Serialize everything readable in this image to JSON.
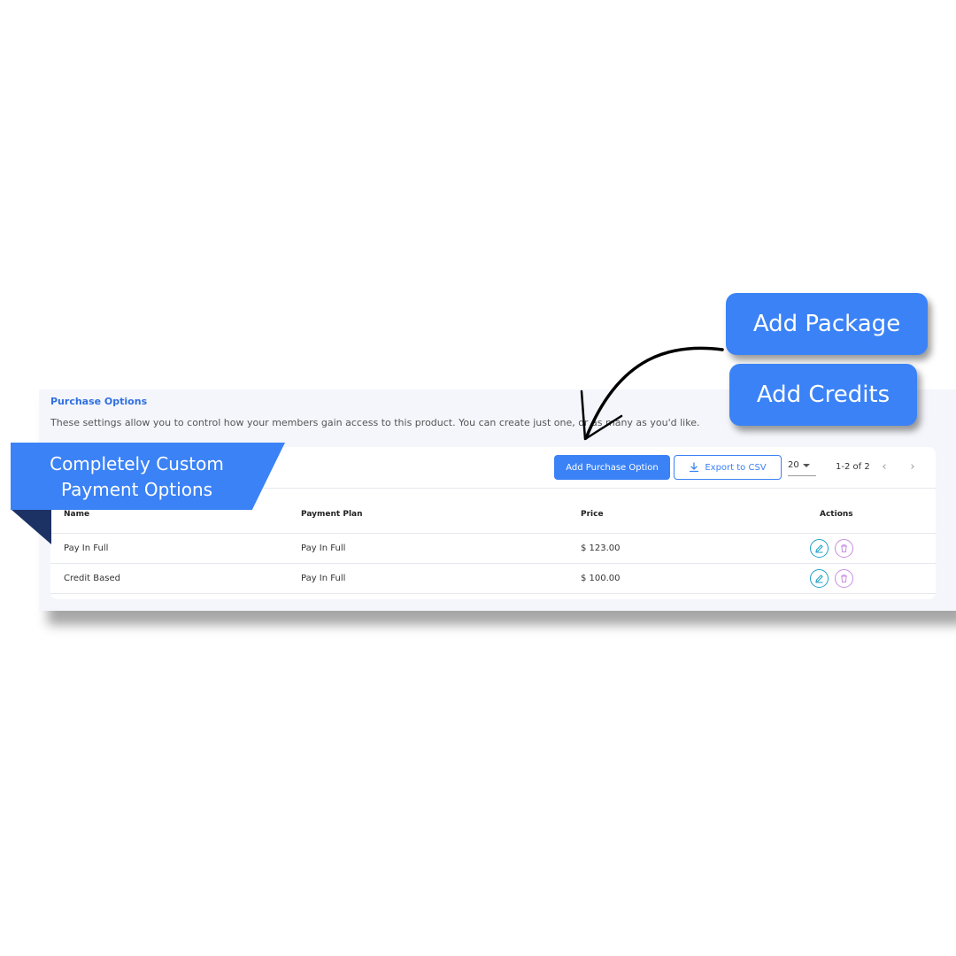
{
  "section": {
    "title": "Purchase Options",
    "description": "These settings allow you to control how your members gain access to this product. You can create just one, or as many as you'd like."
  },
  "toolbar": {
    "add_label": "Add Purchase Option",
    "export_label": "Export to CSV",
    "page_size": "20",
    "pager": "1-2 of 2"
  },
  "table": {
    "headers": [
      "Name",
      "Payment Plan",
      "Price",
      "Actions"
    ],
    "rows": [
      {
        "name": "Pay In Full",
        "plan": "Pay In Full",
        "price": "$ 123.00"
      },
      {
        "name": "Credit Based",
        "plan": "Pay In Full",
        "price": "$ 100.00"
      }
    ]
  },
  "callout": {
    "line1": "Completely Custom",
    "line2": "Payment Options"
  },
  "pills": {
    "package": "Add Package",
    "credits": "Add Credits"
  },
  "colors": {
    "accent": "#3b82f6",
    "ribbon_dark": "#1c3264",
    "edit_icon": "#1ea1c8",
    "delete_icon": "#c98ee0"
  },
  "icons": [
    "download-icon",
    "chevron-left-icon",
    "chevron-right-icon",
    "pencil-icon",
    "trash-icon",
    "curved-arrow-icon"
  ]
}
